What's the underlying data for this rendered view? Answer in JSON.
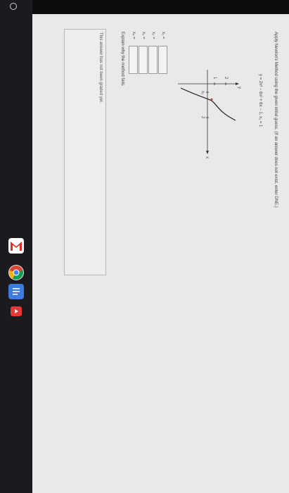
{
  "question": {
    "text": "Apply Newton's Method using the given initial guess. (If an answer does not exist, enter DNE.)",
    "equation": "y = 2x³ − 6x² + 6x − 1,   x₁ = 1"
  },
  "graph": {
    "y_label": "y",
    "x_label": "x",
    "tick_y_2": "2",
    "tick_y_1": "1",
    "tick_x1": "x₁",
    "tick_x_2": "2"
  },
  "answers": [
    {
      "label": "x₁ =",
      "value": ""
    },
    {
      "label": "x₂ =",
      "value": ""
    },
    {
      "label": "x₃ =",
      "value": ""
    },
    {
      "label": "x₄ =",
      "value": ""
    }
  ],
  "explain_prompt": "Explain why the method fails.",
  "explain_value": "",
  "status": "This answer has not been graded yet.",
  "dock": {
    "gmail_letter": "M",
    "docs_letter": "≡",
    "youtube_glyph": "▶"
  },
  "colors": {
    "gmail_red": "#d93025",
    "chrome_red": "#db4437",
    "chrome_yellow": "#f4b400",
    "chrome_green": "#0f9d58",
    "chrome_blue": "#4285f4",
    "docs_blue": "#3b7ce0",
    "youtube_red": "#e53935"
  }
}
